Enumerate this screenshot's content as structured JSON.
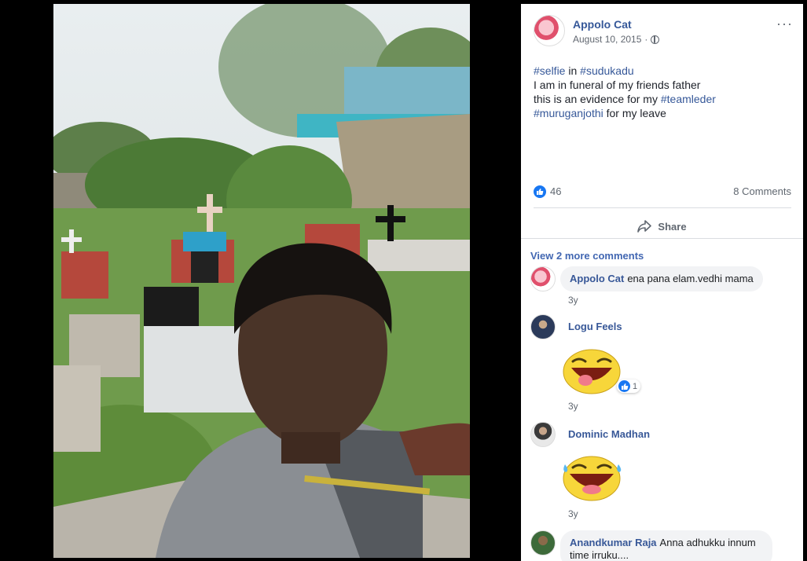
{
  "post": {
    "author": "Appolo Cat",
    "date": "August 10, 2015",
    "more_icon": "···",
    "body": {
      "line1_tag1": "#selfie",
      "line1_mid": " in ",
      "line1_tag2": "#sudukadu",
      "line2": "I am in funeral of my friends father",
      "line3_text": "this is an evidence for my ",
      "line3_tag": "#teamleder",
      "line4_tag": "#muruganjothi",
      "line4_text": " for my leave"
    },
    "likes": "46",
    "comments_count": "8 Comments",
    "share_label": "Share"
  },
  "comments": {
    "view_more": "View 2 more comments",
    "items": [
      {
        "name": "Appolo Cat",
        "text": "ena pana elam.vedhi mama",
        "time": "3y"
      },
      {
        "name": "Logu Feels",
        "sticker": "tongue-laugh-sticker",
        "reaction_count": "1",
        "time": "3y"
      },
      {
        "name": "Dominic Madhan",
        "sticker": "tears-of-joy-sticker",
        "time": "3y"
      },
      {
        "name": "Anandkumar Raja",
        "text": "Anna adhukku innum time irruku....",
        "time": ""
      }
    ]
  },
  "colors": {
    "link": "#365899",
    "like_blue": "#1877f2",
    "bubble_bg": "#f2f3f5",
    "meta_gray": "#606770"
  }
}
